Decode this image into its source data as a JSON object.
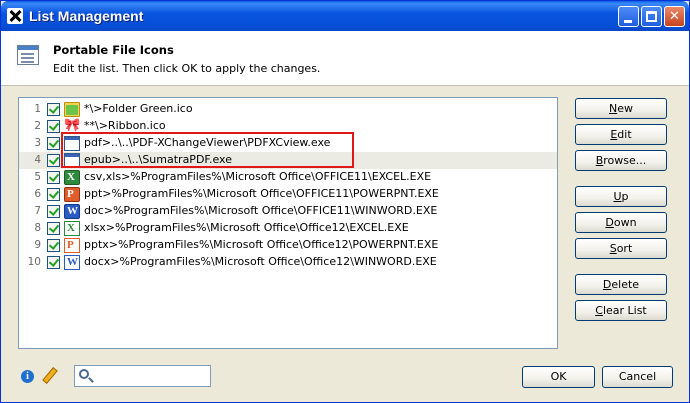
{
  "window": {
    "title": "List Management",
    "buttons": {
      "minimize": "minimize",
      "maximize": "maximize",
      "close": "✕"
    }
  },
  "header": {
    "title": "Portable File Icons",
    "subtitle": "Edit the list. Then click OK to apply the changes."
  },
  "list": {
    "items": [
      {
        "num": "1",
        "checked": true,
        "icon": "folder-icon",
        "text": "*\\>Folder Green.ico"
      },
      {
        "num": "2",
        "checked": true,
        "icon": "ribbon-icon",
        "text": "**\\>Ribbon.ico"
      },
      {
        "num": "3",
        "checked": true,
        "icon": "window-icon",
        "text": "pdf>..\\..\\PDF-XChangeViewer\\PDFXCview.exe"
      },
      {
        "num": "4",
        "checked": true,
        "icon": "window-icon",
        "text": "epub>..\\..\\SumatraPDF.exe",
        "selected": true
      },
      {
        "num": "5",
        "checked": true,
        "icon": "excel-icon",
        "text": "csv,xls>%ProgramFiles%\\Microsoft Office\\OFFICE11\\EXCEL.EXE"
      },
      {
        "num": "6",
        "checked": true,
        "icon": "powerpoint-icon",
        "text": "ppt>%ProgramFiles%\\Microsoft Office\\OFFICE11\\POWERPNT.EXE"
      },
      {
        "num": "7",
        "checked": true,
        "icon": "word-icon",
        "text": "doc>%ProgramFiles%\\Microsoft Office\\OFFICE11\\WINWORD.EXE"
      },
      {
        "num": "8",
        "checked": true,
        "icon": "excel-2007-icon",
        "text": "xlsx>%ProgramFiles%\\Microsoft Office\\Office12\\EXCEL.EXE"
      },
      {
        "num": "9",
        "checked": true,
        "icon": "powerpoint-2007-icon",
        "text": "pptx>%ProgramFiles%\\Microsoft Office\\Office12\\POWERPNT.EXE"
      },
      {
        "num": "10",
        "checked": true,
        "icon": "word-2007-icon",
        "text": "docx>%ProgramFiles%\\Microsoft Office\\Office12\\WINWORD.EXE"
      }
    ]
  },
  "buttons": {
    "new": {
      "u": "N",
      "rest": "ew"
    },
    "edit": {
      "u": "E",
      "rest": "dit"
    },
    "browse": {
      "u": "B",
      "rest": "rowse..."
    },
    "up": {
      "u": "U",
      "rest": "p"
    },
    "down": {
      "u": "D",
      "rest": "own"
    },
    "sort": {
      "u": "S",
      "rest": "ort"
    },
    "delete": {
      "u": "D",
      "rest": "elete"
    },
    "clear": {
      "u": "C",
      "rest": "lear List"
    },
    "ok": "OK",
    "cancel": "Cancel"
  },
  "search": {
    "value": "",
    "placeholder": ""
  },
  "colors": {
    "titlebar": "#0a55e0",
    "highlight": "#e01818",
    "check": "#21a121"
  }
}
